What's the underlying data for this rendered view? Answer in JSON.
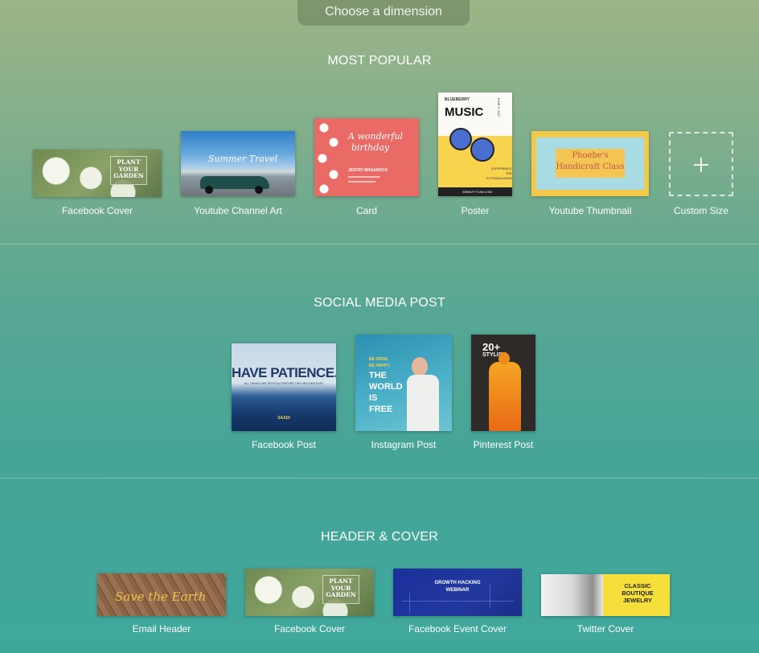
{
  "header": {
    "choose_label": "Choose a dimension"
  },
  "sections": {
    "popular": {
      "title": "MOST POPULAR",
      "items": [
        {
          "label": "Facebook Cover",
          "thumb_text": [
            "PLANT",
            "YOUR",
            "GARDEN"
          ]
        },
        {
          "label": "Youtube Channel Art",
          "thumb_text": [
            "Summer Travel"
          ]
        },
        {
          "label": "Card",
          "thumb_text": [
            "A wonderful",
            "birthday",
            "JEFFRY BRAANOCK"
          ]
        },
        {
          "label": "Poster",
          "thumb_text": [
            "BLUEBERRY",
            "MUSIC",
            "JUNE 5, 2017",
            "EXPERIENCE",
            "THE",
            "EXTRAVAGANZA",
            "WWW.FYTUW.COM"
          ]
        },
        {
          "label": "Youtube Thumbnail",
          "thumb_text": [
            "Phoebe's",
            "Handicraft Class"
          ]
        },
        {
          "label": "Custom Size",
          "icon": "plus-icon"
        }
      ]
    },
    "social": {
      "title": "SOCIAL MEDIA POST",
      "items": [
        {
          "label": "Facebook Post",
          "thumb_text": [
            "HAVE PATIENCE.",
            "ALL THINGS ARE DIFFICULT BEFORE THEY BECOME EASY",
            "SAADI"
          ]
        },
        {
          "label": "Instagram Post",
          "thumb_text": [
            "BE OPEN.",
            "BE HAPPY.",
            "THE",
            "WORLD",
            "IS",
            "FREE"
          ]
        },
        {
          "label": "Pinterest Post",
          "thumb_text": [
            "20+",
            "STYLISH"
          ]
        }
      ]
    },
    "header_cover": {
      "title": "HEADER & COVER",
      "items": [
        {
          "label": "Email Header",
          "thumb_text": [
            "Save the Earth"
          ]
        },
        {
          "label": "Facebook Cover",
          "thumb_text": [
            "PLANT",
            "YOUR",
            "GARDEN"
          ]
        },
        {
          "label": "Facebook Event Cover",
          "thumb_text": [
            "GROWTH HACKING",
            "WEBINAR"
          ]
        },
        {
          "label": "Twitter Cover",
          "thumb_text": [
            "CLASSIC",
            "BOUTIQUE",
            "JEWELRY"
          ]
        }
      ]
    }
  },
  "colors": {
    "bg_top": "#9db587",
    "bg_bottom": "#3fa89c",
    "card_coral": "#ea6a66",
    "poster_yellow": "#f7d34e",
    "blueberry": "#4a6fd0",
    "yt_thumb_yellow": "#f3c94a",
    "event_blue": "#1a2f9a",
    "twitter_yellow": "#f6df3a"
  }
}
